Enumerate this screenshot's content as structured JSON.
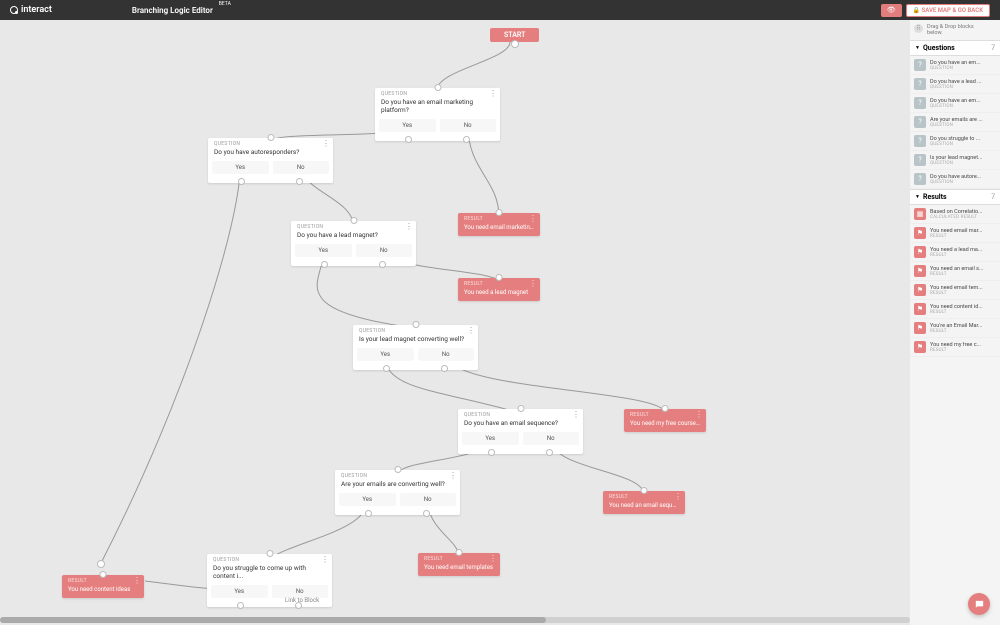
{
  "app": {
    "brand": "interact",
    "title": "Branching Logic Editor",
    "beta": "BETA"
  },
  "toolbar": {
    "save": "SAVE MAP & GO BACK"
  },
  "start": "START",
  "labels": {
    "question": "QUESTION",
    "result": "RESULT",
    "calculated": "CALCULATED RESULT",
    "yes": "Yes",
    "no": "No",
    "linkToBlock": "Link to Block"
  },
  "hint": {
    "line1": "Drag & Drop blocks",
    "line2": "below."
  },
  "sections": {
    "questions": "Questions",
    "results": "Results",
    "qcount": "7",
    "rcount": "7"
  },
  "nodes": {
    "q1": "Do you have an email marketing platform?",
    "q2": "Do you have autoresponders?",
    "q3": "Do you have a lead magnet?",
    "q4": "Is your lead magnet converting well?",
    "q5": "Do you have an email sequence?",
    "q6": "Are your emails are converting well?",
    "q7": "Do you struggle to come up with content i...",
    "r1": "You need email marketing s...",
    "r2": "You need a lead magnet",
    "r3": "You need my free course o...",
    "r4": "You need an email sequence",
    "r5": "You need email templates",
    "r6": "You need content ideas"
  },
  "sidebar": {
    "questions": [
      "Do you have an em...",
      "Do you have a lead ...",
      "Do you have an em...",
      "Are your emails are ...",
      "Do you struggle to ...",
      "Is your lead magnet...",
      "Do you have autore..."
    ],
    "results": [
      {
        "t": "Based on Correlatio...",
        "s": "CALCULATED RESULT",
        "c": true
      },
      {
        "t": "You need email mar...",
        "s": "RESULT"
      },
      {
        "t": "You need a lead ma...",
        "s": "RESULT"
      },
      {
        "t": "You need an email s...",
        "s": "RESULT"
      },
      {
        "t": "You need email tem...",
        "s": "RESULT"
      },
      {
        "t": "You need content id...",
        "s": "RESULT"
      },
      {
        "t": "You're an Email Mar...",
        "s": "RESULT"
      },
      {
        "t": "You need my free c...",
        "s": "RESULT"
      }
    ]
  }
}
